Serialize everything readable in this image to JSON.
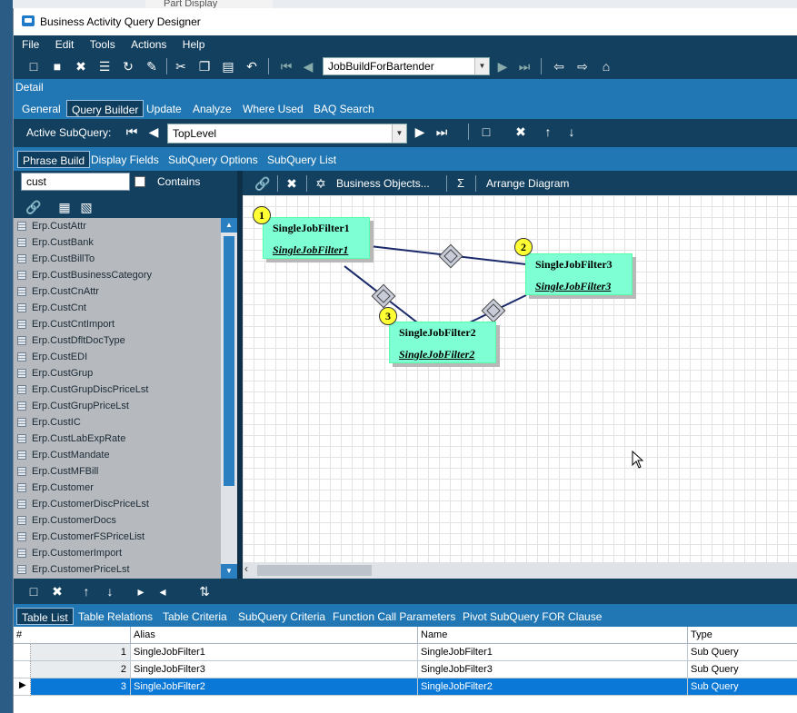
{
  "background": {
    "tab_label": "Part Display"
  },
  "window": {
    "title": "Business Activity Query Designer"
  },
  "menu": [
    "File",
    "Edit",
    "Tools",
    "Actions",
    "Help"
  ],
  "toolbar": {
    "nav_combo": "JobBuildForBartender"
  },
  "detail_label": "Detail",
  "main_tabs": [
    "General",
    "Query Builder",
    "Update",
    "Analyze",
    "Where Used",
    "BAQ Search"
  ],
  "subquery": {
    "label": "Active SubQuery:",
    "value": "TopLevel"
  },
  "phrase_tabs": [
    "Phrase Build",
    "Display Fields",
    "SubQuery Options",
    "SubQuery List"
  ],
  "search": {
    "value": "cust",
    "contains_label": "Contains"
  },
  "tables": [
    "Erp.CustAttr",
    "Erp.CustBank",
    "Erp.CustBillTo",
    "Erp.CustBusinessCategory",
    "Erp.CustCnAttr",
    "Erp.CustCnt",
    "Erp.CustCntImport",
    "Erp.CustDfltDocType",
    "Erp.CustEDI",
    "Erp.CustGrup",
    "Erp.CustGrupDiscPriceLst",
    "Erp.CustGrupPriceLst",
    "Erp.CustIC",
    "Erp.CustLabExpRate",
    "Erp.CustMandate",
    "Erp.CustMFBill",
    "Erp.Customer",
    "Erp.CustomerDiscPriceLst",
    "Erp.CustomerDocs",
    "Erp.CustomerFSPriceList",
    "Erp.CustomerImport",
    "Erp.CustomerPriceLst"
  ],
  "diagram_tools": {
    "business_objects": "Business Objects...",
    "sigma": "Σ",
    "arrange": "Arrange Diagram"
  },
  "nodes": [
    {
      "num": "1",
      "title": "SingleJobFilter1",
      "alias": "SingleJobFilter1"
    },
    {
      "num": "2",
      "title": "SingleJobFilter3",
      "alias": "SingleJobFilter3"
    },
    {
      "num": "3",
      "title": "SingleJobFilter2",
      "alias": "SingleJobFilter2"
    }
  ],
  "bottom_tabs": [
    "Table List",
    "Table Relations",
    "Table Criteria",
    "SubQuery Criteria",
    "Function Call Parameters",
    "Pivot SubQuery FOR Clause"
  ],
  "grid": {
    "headers": [
      "#",
      "Alias",
      "Name",
      "Type"
    ],
    "rows": [
      {
        "num": "1",
        "alias": "SingleJobFilter1",
        "name": "SingleJobFilter1",
        "type": "Sub Query"
      },
      {
        "num": "2",
        "alias": "SingleJobFilter3",
        "name": "SingleJobFilter3",
        "type": "Sub Query"
      },
      {
        "num": "3",
        "alias": "SingleJobFilter2",
        "name": "SingleJobFilter2",
        "type": "Sub Query"
      }
    ]
  },
  "colors": {
    "nav_dark": "#13405f",
    "tab_blue": "#2177b3",
    "node_fill": "#7fffd4",
    "badge": "#ffff33",
    "select_row": "#0a78d7"
  }
}
